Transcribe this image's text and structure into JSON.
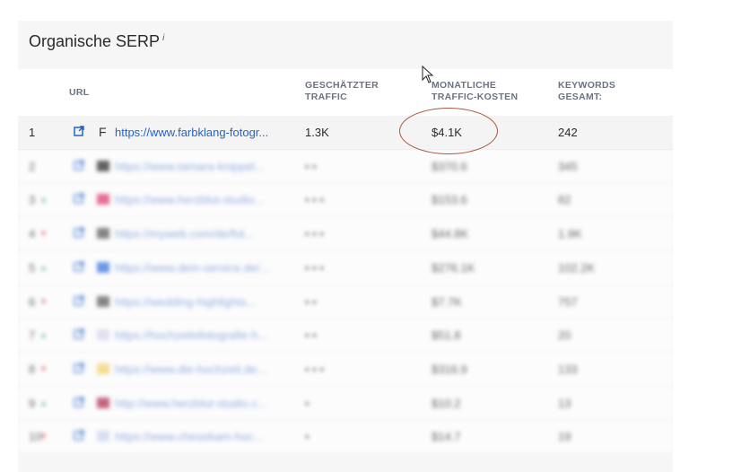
{
  "panel": {
    "title": "Organische SERP",
    "info_mark": "i"
  },
  "headers": {
    "url": "URL",
    "traffic_line1": "GESCHÄTZTER",
    "traffic_line2": "TRAFFIC",
    "cost_line1": "MONATLICHE",
    "cost_line2": "TRAFFIC-KOSTEN",
    "kw_line1": "KEYWORDS",
    "kw_line2": "GESAMT:"
  },
  "rows": [
    {
      "rank": "1",
      "fav": "F",
      "url": "https://www.farbklang-fotogr...",
      "traffic": "1.3K",
      "cost": "$4.1K",
      "keywords": "242",
      "blurred": false
    },
    {
      "rank": "2",
      "url": "https://www.tamara-knippel...",
      "traffic": "• •",
      "cost": "$370.6",
      "keywords": "345",
      "blurred": true,
      "favcolor": "#222222"
    },
    {
      "rank": "3",
      "url": "https://www.herzblut-studio...",
      "traffic": "• • •",
      "cost": "$153.6",
      "keywords": "82",
      "blurred": true,
      "favcolor": "#e0346a",
      "chg": "up"
    },
    {
      "rank": "4",
      "url": "https://myweb.com/de/fot...",
      "traffic": "• • •",
      "cost": "$44.8K",
      "keywords": "1.9K",
      "blurred": true,
      "favcolor": "#555555",
      "chg": "dn"
    },
    {
      "rank": "5",
      "url": "https://www.dein-service.de/...",
      "traffic": "• • •",
      "cost": "$276.1K",
      "keywords": "102.2K",
      "blurred": true,
      "favcolor": "#2f6fe0",
      "chg": "up"
    },
    {
      "rank": "6",
      "url": "https://wedding-highlights...",
      "traffic": "• •",
      "cost": "$7.7K",
      "keywords": "757",
      "blurred": true,
      "favcolor": "#555555",
      "chg": "dn"
    },
    {
      "rank": "7",
      "url": "https://hochzeitsfotografie-h...",
      "traffic": "• •",
      "cost": "$51.8",
      "keywords": "20",
      "blurred": true,
      "favcolor": "#d9d6f0",
      "chg": "up"
    },
    {
      "rank": "8",
      "url": "https://www.die-hochzeit.de...",
      "traffic": "• • •",
      "cost": "$316.9",
      "keywords": "133",
      "blurred": true,
      "favcolor": "#f5d36a",
      "chg": "dn"
    },
    {
      "rank": "9",
      "url": "http://www.herzblut-studio.c...",
      "traffic": "•",
      "cost": "$10.2",
      "keywords": "13",
      "blurred": true,
      "favcolor": "#b0284c",
      "chg": "up"
    },
    {
      "rank": "10",
      "url": "https://www.chesekam-hoc...",
      "traffic": "•",
      "cost": "$14.7",
      "keywords": "19",
      "blurred": true,
      "favcolor": "#cfd4f2",
      "chg": "dn"
    }
  ],
  "colors": {
    "link": "#2563c9",
    "annotation_circle": "#a8583f"
  },
  "icons": {
    "external_link": "external-link-icon",
    "cursor": "mouse-cursor-icon"
  }
}
